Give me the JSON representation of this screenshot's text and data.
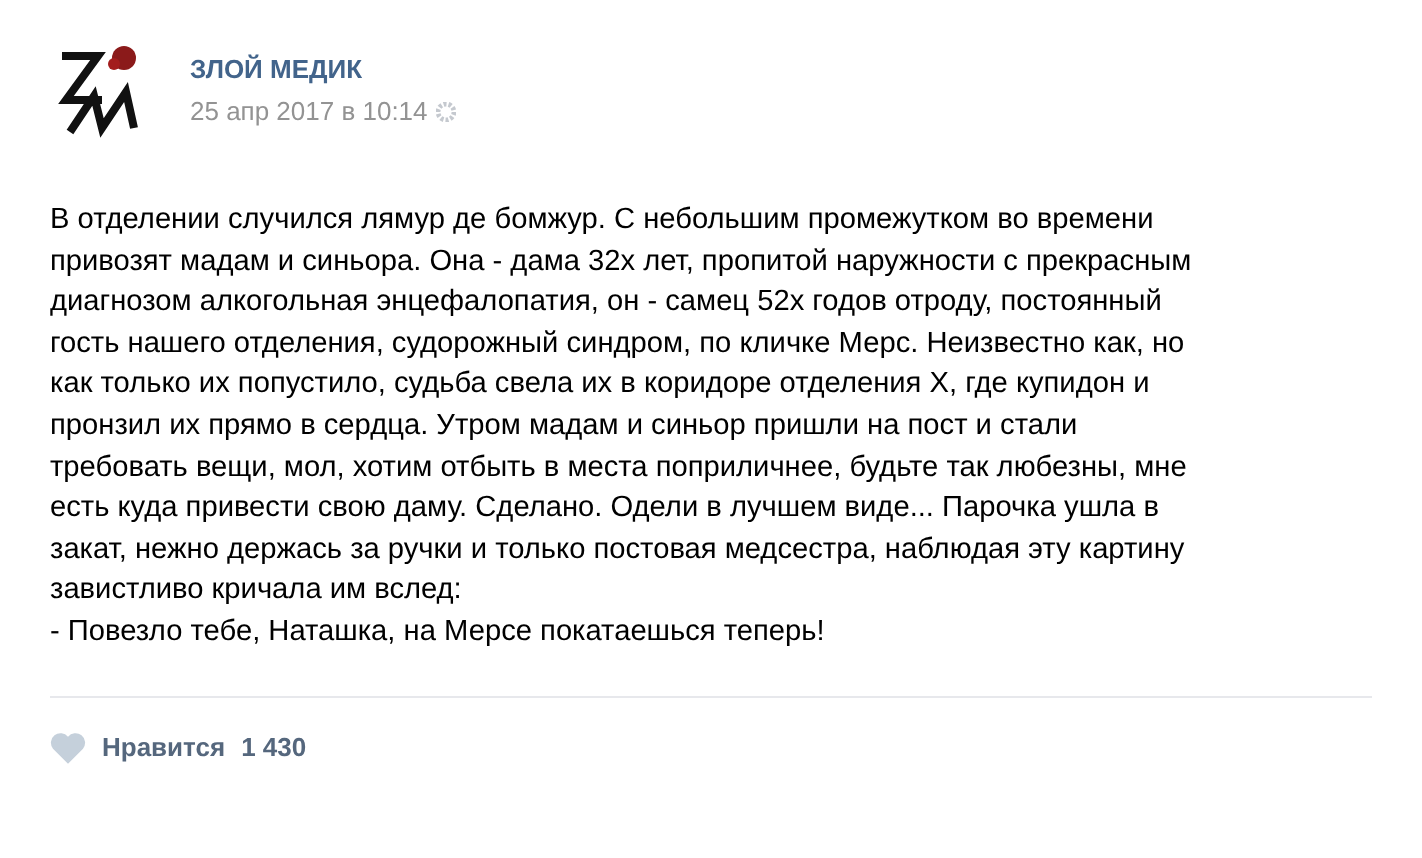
{
  "post": {
    "author": "ЗЛОЙ МЕДИК",
    "date": "25 апр 2017 в 10:14",
    "text_lines": [
      "В отделении случился лямур де бомжур. С небольшим промежутком во времени",
      "привозят мадам и синьора. Она - дама 32х лет, пропитой наружности с прекрасным",
      "диагнозом алкогольная энцефалопатия, он - самец 52х годов отроду, постоянный",
      "гость нашего отделения, судорожный синдром, по кличке Мерс. Неизвестно как, но",
      "как только их попустило, судьба свела их в коридоре отделения Х, где купидон и",
      "пронзил их прямо в сердца. Утром мадам и синьор пришли на пост и стали",
      "требовать вещи, мол, хотим отбыть в места поприличнее, будьте так любезны, мне",
      "есть куда привести свою даму. Сделано. Одели в лучшем виде... Парочка ушла в",
      "закат, нежно держась за ручки и только постовая медсестра, наблюдая эту картину",
      "завистливо кричала им вслед:",
      "- Повезло тебе, Наташка, на Мерсе покатаешься теперь!"
    ],
    "like": {
      "label": "Нравится",
      "count": "1 430",
      "liked": false
    }
  }
}
